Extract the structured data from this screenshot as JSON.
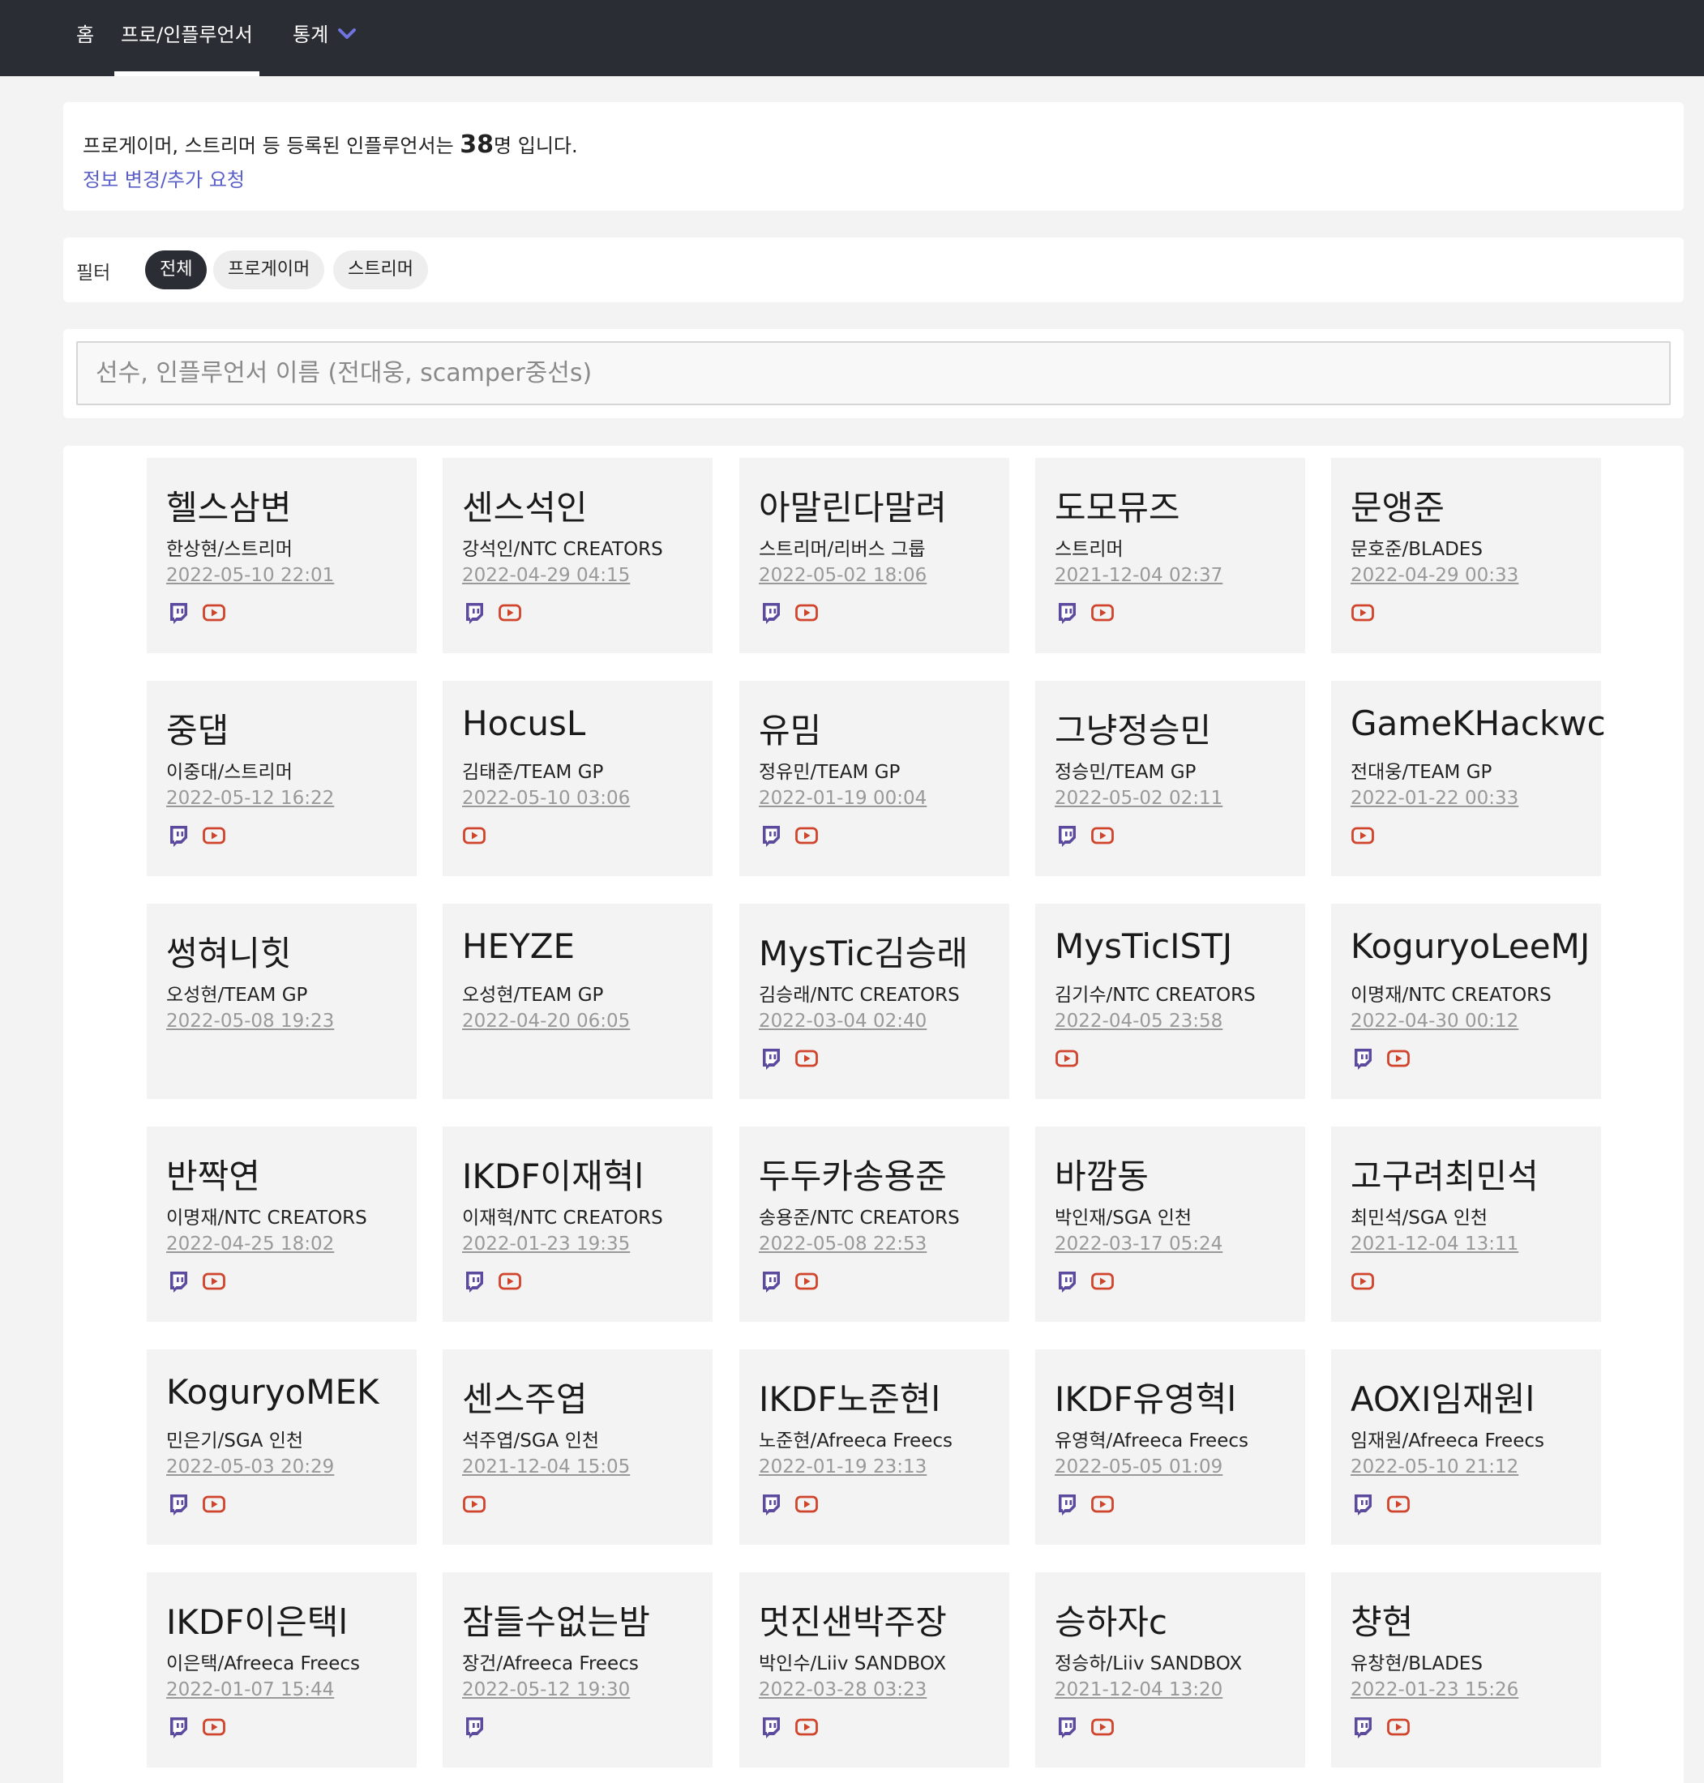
{
  "nav": {
    "items": [
      {
        "label": "홈"
      },
      {
        "label": "프로/인플루언서"
      },
      {
        "label": "통계"
      }
    ],
    "active_index": 1
  },
  "info": {
    "text_before": "프로게이머, 스트리머 등 등록된 인플루언서는 ",
    "count": "38",
    "text_after": "명 입니다.",
    "link": "정보 변경/추가 요청"
  },
  "filter": {
    "label": "필터",
    "chips": [
      {
        "label": "전체"
      },
      {
        "label": "프로게이머"
      },
      {
        "label": "스트리머"
      }
    ],
    "active_index": 0
  },
  "search": {
    "placeholder": "선수, 인플루언서 이름 (전대웅, scamper중선s)",
    "value": ""
  },
  "colors": {
    "twitch": "#5b4a9e",
    "youtube": "#d0442c",
    "accent_link": "#5a5fc8",
    "nav_bg": "#2a2d33"
  },
  "icons": {
    "twitch": "twitch-icon",
    "youtube": "youtube-icon",
    "chevron": "chevron-down-icon"
  },
  "cards": [
    {
      "name": "헬스삼변",
      "sub": "한상현/스트리머",
      "date": "2022-05-10 22:01",
      "twitch": true,
      "youtube": true
    },
    {
      "name": "센스석인",
      "sub": "강석인/NTC CREATORS",
      "date": "2022-04-29 04:15",
      "twitch": true,
      "youtube": true
    },
    {
      "name": "아말린다말려",
      "sub": "스트리머/리버스 그룹",
      "date": "2022-05-02 18:06",
      "twitch": true,
      "youtube": true
    },
    {
      "name": "도모뮤즈",
      "sub": "스트리머",
      "date": "2021-12-04 02:37",
      "twitch": true,
      "youtube": true
    },
    {
      "name": "문앵준",
      "sub": "문호준/BLADES",
      "date": "2022-04-29 00:33",
      "twitch": false,
      "youtube": true
    },
    {
      "name": "중댑",
      "sub": "이중대/스트리머",
      "date": "2022-05-12 16:22",
      "twitch": true,
      "youtube": true
    },
    {
      "name": "HocusL",
      "sub": "김태준/TEAM GP",
      "date": "2022-05-10 03:06",
      "twitch": false,
      "youtube": true
    },
    {
      "name": "유밈",
      "sub": "정유민/TEAM GP",
      "date": "2022-01-19 00:04",
      "twitch": true,
      "youtube": true
    },
    {
      "name": "그냥정승민",
      "sub": "정승민/TEAM GP",
      "date": "2022-05-02 02:11",
      "twitch": true,
      "youtube": true
    },
    {
      "name": "GameKHackwc",
      "sub": "전대웅/TEAM GP",
      "date": "2022-01-22 00:33",
      "twitch": false,
      "youtube": true
    },
    {
      "name": "썽혀니힛",
      "sub": "오성현/TEAM GP",
      "date": "2022-05-08 19:23",
      "twitch": false,
      "youtube": false
    },
    {
      "name": "HEYZE",
      "sub": "오성현/TEAM GP",
      "date": "2022-04-20 06:05",
      "twitch": false,
      "youtube": false
    },
    {
      "name": "MysTic김승래",
      "sub": "김승래/NTC CREATORS",
      "date": "2022-03-04 02:40",
      "twitch": true,
      "youtube": true
    },
    {
      "name": "MysTicISTJ",
      "sub": "김기수/NTC CREATORS",
      "date": "2022-04-05 23:58",
      "twitch": false,
      "youtube": true
    },
    {
      "name": "KoguryoLeeMJ",
      "sub": "이명재/NTC CREATORS",
      "date": "2022-04-30 00:12",
      "twitch": true,
      "youtube": true
    },
    {
      "name": "반짝연",
      "sub": "이명재/NTC CREATORS",
      "date": "2022-04-25 18:02",
      "twitch": true,
      "youtube": true
    },
    {
      "name": "IKDF이재혁l",
      "sub": "이재혁/NTC CREATORS",
      "date": "2022-01-23 19:35",
      "twitch": true,
      "youtube": true
    },
    {
      "name": "두두카송용준",
      "sub": "송용준/NTC CREATORS",
      "date": "2022-05-08 22:53",
      "twitch": true,
      "youtube": true
    },
    {
      "name": "바깜동",
      "sub": "박인재/SGA 인천",
      "date": "2022-03-17 05:24",
      "twitch": true,
      "youtube": true
    },
    {
      "name": "고구려최민석",
      "sub": "최민석/SGA 인천",
      "date": "2021-12-04 13:11",
      "twitch": false,
      "youtube": true
    },
    {
      "name": "KoguryoMEK",
      "sub": "민은기/SGA 인천",
      "date": "2022-05-03 20:29",
      "twitch": true,
      "youtube": true
    },
    {
      "name": "센스주엽",
      "sub": "석주엽/SGA 인천",
      "date": "2021-12-04 15:05",
      "twitch": false,
      "youtube": true
    },
    {
      "name": "IKDF노준현l",
      "sub": "노준현/Afreeca Freecs",
      "date": "2022-01-19 23:13",
      "twitch": true,
      "youtube": true
    },
    {
      "name": "IKDF유영혁l",
      "sub": "유영혁/Afreeca Freecs",
      "date": "2022-05-05 01:09",
      "twitch": true,
      "youtube": true
    },
    {
      "name": "AOXI임재원l",
      "sub": "임재원/Afreeca Freecs",
      "date": "2022-05-10 21:12",
      "twitch": true,
      "youtube": true
    },
    {
      "name": "IKDF이은택l",
      "sub": "이은택/Afreeca Freecs",
      "date": "2022-01-07 15:44",
      "twitch": true,
      "youtube": true
    },
    {
      "name": "잠들수없는밤",
      "sub": "장건/Afreeca Freecs",
      "date": "2022-05-12 19:30",
      "twitch": true,
      "youtube": false
    },
    {
      "name": "멋진샌박주장",
      "sub": "박인수/Liiv SANDBOX",
      "date": "2022-03-28 03:23",
      "twitch": true,
      "youtube": true
    },
    {
      "name": "승하자c",
      "sub": "정승하/Liiv SANDBOX",
      "date": "2021-12-04 13:20",
      "twitch": true,
      "youtube": true
    },
    {
      "name": "챵현",
      "sub": "유창현/BLADES",
      "date": "2022-01-23 15:26",
      "twitch": true,
      "youtube": true
    }
  ]
}
